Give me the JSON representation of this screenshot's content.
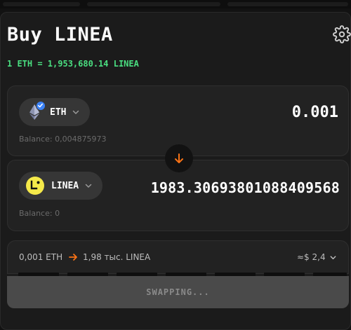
{
  "title": "Buy LINEA",
  "rate": "1 ETH = 1,953,680.14 LINEA",
  "sell": {
    "token": "ETH",
    "amount": "0.001",
    "balance": "Balance: 0,004875973"
  },
  "buy": {
    "token": "LINEA",
    "amount": "1983.3069380108840956​8",
    "balance": "Balance: 0"
  },
  "route": {
    "from": "0,001 ETH",
    "to": "1,98 тыс. LINEA",
    "usd": "≈$ 2,4"
  },
  "swap_button": "SWAPPING...",
  "colors": {
    "accent_green": "#4ade80",
    "accent_orange": "#f97316",
    "verified_blue": "#3b82f6",
    "linea_yellow": "#f5e94a"
  },
  "icons": [
    "settings-gear-icon",
    "eth-icon",
    "verified-badge-icon",
    "chevron-down-icon",
    "linea-icon",
    "arrow-down-icon",
    "arrow-right-icon"
  ]
}
